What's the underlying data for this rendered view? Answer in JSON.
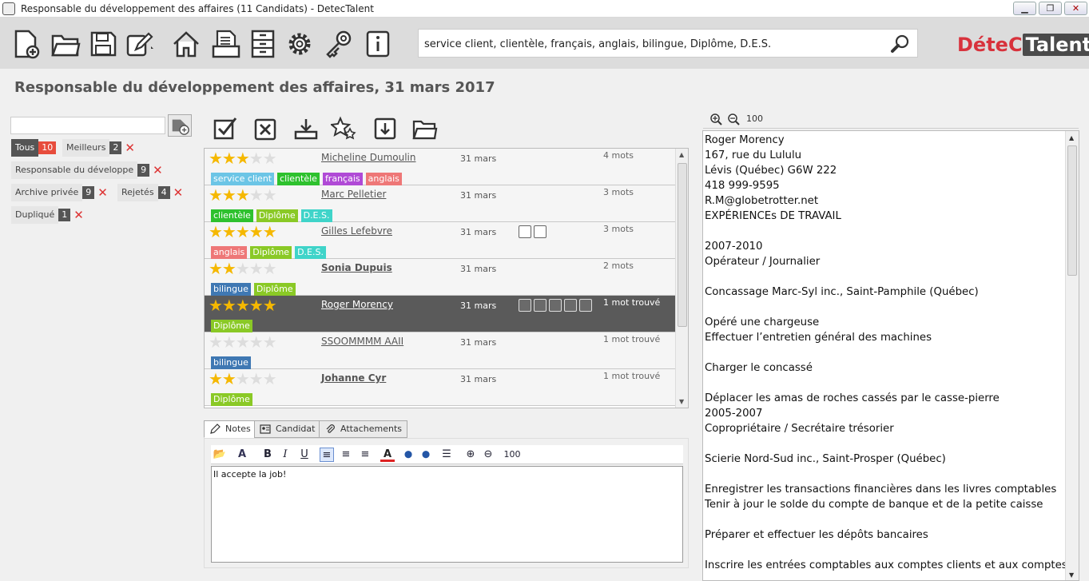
{
  "window": {
    "title": "Responsable du développement des affaires (11 Candidats) - DetecTalent",
    "min": "▁",
    "max": "❐",
    "close": "✕"
  },
  "search": {
    "value": "service client, clientèle, français, anglais, bilingue, Diplôme, D.E.S."
  },
  "logo": {
    "part1": "DéteC",
    "part2": "Talent"
  },
  "page_title": "Responsable du développement des affaires, 31 mars 2017",
  "filters": [
    {
      "label": "Tous",
      "count": "10"
    },
    {
      "label": "Meilleurs",
      "count": "2",
      "x": "✕"
    },
    {
      "label": "Responsable du développe",
      "count": "9",
      "x": "✕"
    },
    {
      "label": "Archive privée",
      "count": "9",
      "x": "✕"
    },
    {
      "label": "Rejetés",
      "count": "4",
      "x": "✕"
    },
    {
      "label": "Dupliqué",
      "count": "1",
      "x": "✕"
    }
  ],
  "candidates": [
    {
      "stars": "★★★",
      "stars_off": "★★",
      "rating": 3,
      "name": "Micheline Dumoulin",
      "date": "31 mars",
      "mots": "4 mots",
      "tags": [
        {
          "t": "service client",
          "c": "#6cc5e6"
        },
        {
          "t": "clientèle",
          "c": "#2ec12e"
        },
        {
          "t": "français",
          "c": "#b04ad6"
        },
        {
          "t": "anglais",
          "c": "#ee7777"
        }
      ]
    },
    {
      "stars": "★★★",
      "stars_off": "★★",
      "rating": 3,
      "name": "Marc Pelletier",
      "date": "31 mars",
      "mots": "3 mots",
      "tags": [
        {
          "t": "clientèle",
          "c": "#2ec12e"
        },
        {
          "t": "Diplôme",
          "c": "#8ac926"
        },
        {
          "t": "D.E.S.",
          "c": "#3fd4c9"
        }
      ]
    },
    {
      "stars": "★★★★★",
      "stars_off": "",
      "rating": 5,
      "name": "Gilles Lefebvre",
      "date": "31 mars",
      "mots": "3 mots",
      "tags": [
        {
          "t": "anglais",
          "c": "#ee7777"
        },
        {
          "t": "Diplôme",
          "c": "#8ac926"
        },
        {
          "t": "D.E.S.",
          "c": "#3fd4c9"
        }
      ]
    },
    {
      "stars": "★★",
      "stars_off": "★★★",
      "rating": 2,
      "name": "Sonia Dupuis",
      "date": "31 mars",
      "mots": "2 mots",
      "tags": [
        {
          "t": "bilingue",
          "c": "#3f78b3"
        },
        {
          "t": "Diplôme",
          "c": "#8ac926"
        }
      ]
    },
    {
      "stars": "★★★★★",
      "stars_off": "",
      "rating": 5,
      "name": "Roger Morency",
      "date": "31 mars",
      "mots": "1 mot trouvé",
      "tags": [
        {
          "t": "Diplôme",
          "c": "#8ac926"
        }
      ]
    },
    {
      "stars": "",
      "stars_off": "★★★★★",
      "rating": 0,
      "name": "SSOOMMMM AAII",
      "date": "31 mars",
      "mots": "1 mot trouvé",
      "tags": [
        {
          "t": "bilingue",
          "c": "#3f78b3"
        }
      ]
    },
    {
      "stars": "★★",
      "stars_off": "★★★",
      "rating": 2,
      "name": "Johanne Cyr",
      "date": "31 mars",
      "mots": "1 mot trouvé",
      "tags": [
        {
          "t": "Diplôme",
          "c": "#8ac926"
        }
      ]
    }
  ],
  "tabs": [
    {
      "label": "Notes"
    },
    {
      "label": "Candidat"
    },
    {
      "label": "Attachements"
    }
  ],
  "editor": {
    "zoom": "100",
    "bold": "B",
    "italic": "I",
    "underline": "U",
    "font": "A",
    "text": "Il accepte la job!"
  },
  "resume": {
    "zoom": "100",
    "lines": [
      "Roger Morency",
      "167, rue du Lululu",
      "Lévis (Québec)  G6W 222",
      "418 999-9595",
      "R.M@globetrotter.net",
      "EXPÉRIENCEs DE TRAVAIL",
      "",
      "2007-2010",
      "Opérateur / Journalier",
      "",
      "Concassage Marc-Syl inc., Saint-Pamphile (Québec)",
      "",
      "Opéré une chargeuse",
      "Effectuer l’entretien général des machines",
      "",
      "Charger le concassé",
      "",
      "Déplacer les amas de roches cassés par le casse-pierre",
      "2005-2007",
      "Copropriétaire / Secrétaire trésorier",
      "",
      "Scierie Nord-Sud inc., Saint-Prosper (Québec)",
      "",
      "Enregistrer les transactions financières dans les livres comptables",
      "Tenir à jour le solde du compte de banque et de la petite caisse",
      "",
      "Préparer et effectuer les dépôts bancaires",
      "",
      "Inscrire les entrées comptables aux comptes clients et aux comptes"
    ]
  }
}
